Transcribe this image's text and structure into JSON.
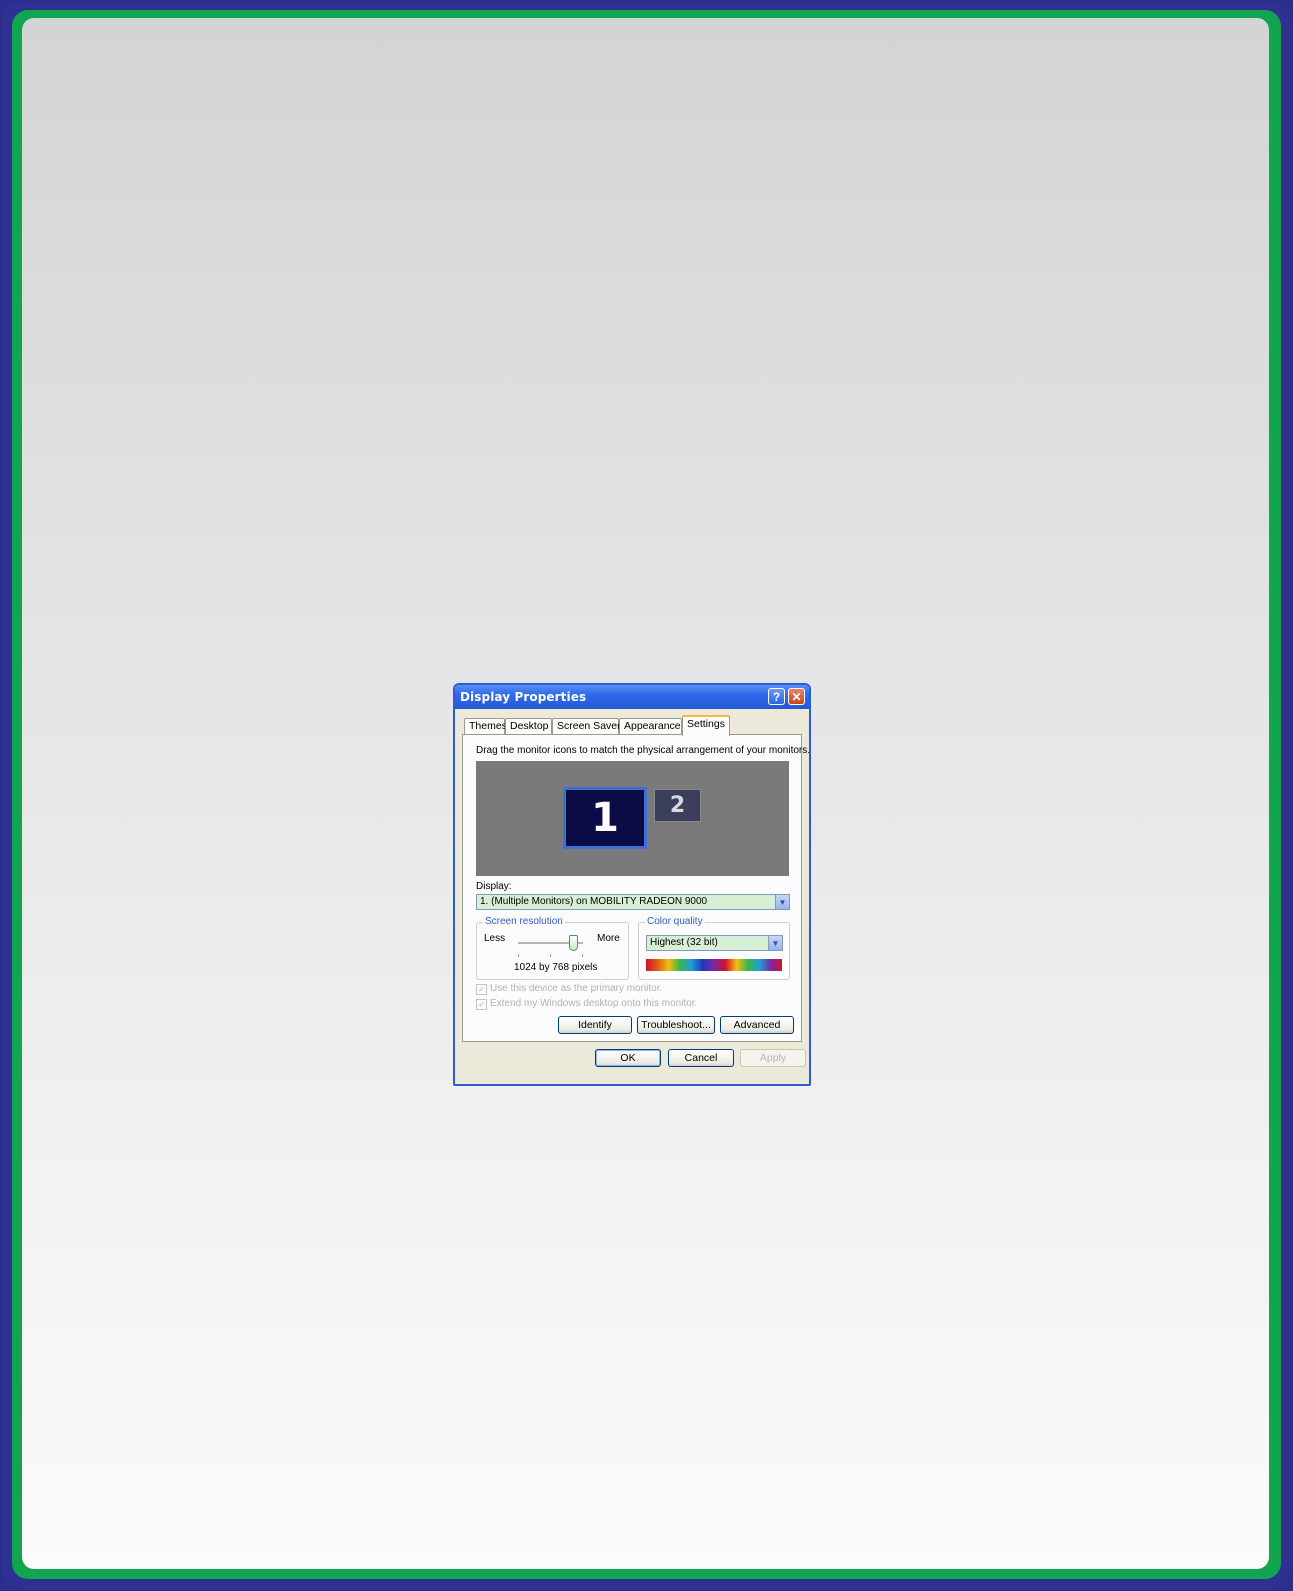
{
  "dialog": {
    "title": "Display Properties",
    "help_glyph": "?",
    "close_glyph": "✕"
  },
  "tabs": [
    {
      "label": "Themes"
    },
    {
      "label": "Desktop"
    },
    {
      "label": "Screen Saver"
    },
    {
      "label": "Appearance"
    },
    {
      "label": "Settings",
      "active": true
    }
  ],
  "settings": {
    "instruction": "Drag the monitor icons to match the physical arrangement of your monitors.",
    "monitors": [
      {
        "label": "1",
        "selected": true
      },
      {
        "label": "2",
        "selected": false
      }
    ],
    "display_label": "Display:",
    "display_value": "1. (Multiple Monitors) on MOBILITY RADEON 9000",
    "screen_resolution": {
      "title": "Screen resolution",
      "less_label": "Less",
      "more_label": "More",
      "value_text": "1024 by 768 pixels"
    },
    "color_quality": {
      "title": "Color quality",
      "value": "Highest (32 bit)"
    },
    "checkboxes": [
      {
        "label": "Use this device as the primary monitor.",
        "checked": true,
        "disabled": true
      },
      {
        "label": "Extend my Windows desktop onto this monitor.",
        "checked": true,
        "disabled": true
      }
    ],
    "buttons": {
      "identify": "Identify",
      "troubleshoot": "Troubleshoot...",
      "advanced": "Advanced"
    }
  },
  "footer": {
    "ok": "OK",
    "cancel": "Cancel",
    "apply": "Apply"
  },
  "colors": {
    "frame_outer": "#2e3192",
    "frame_green": "#12a44f",
    "titlebar": "#2459d6",
    "monitor_selected": "#0b0b45",
    "monitor_area": "#7a7a7a",
    "group_title": "#2f5dca"
  }
}
